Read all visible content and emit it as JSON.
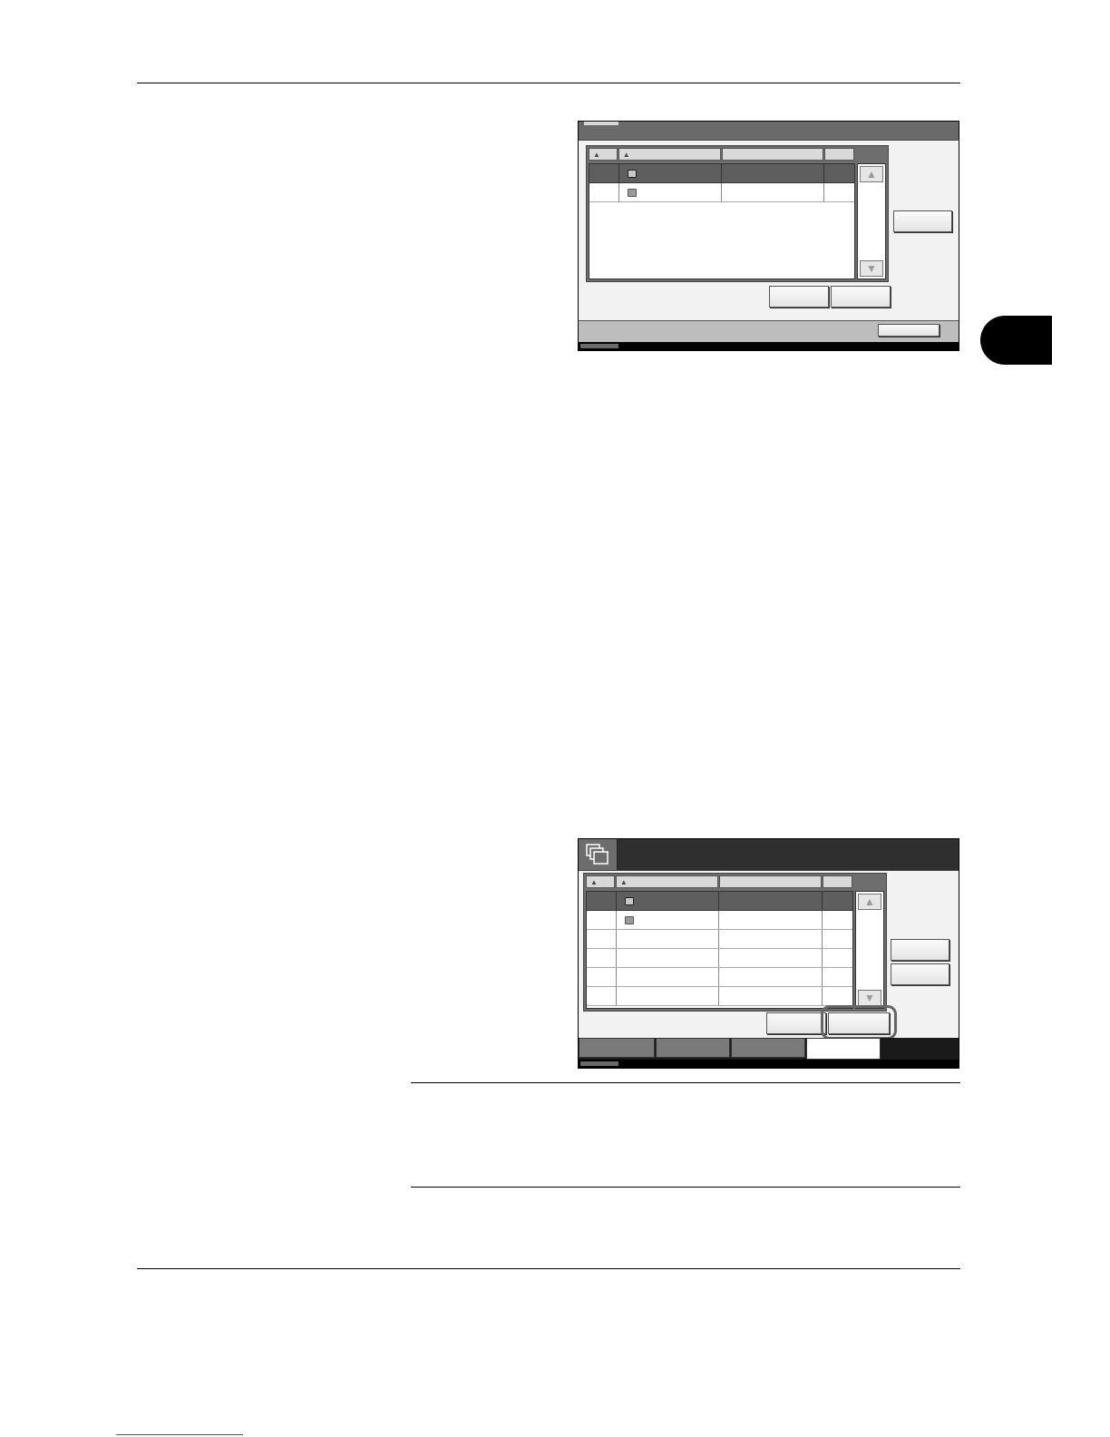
{
  "page": {
    "header_rule": true,
    "chapter_tab": {
      "number": ""
    },
    "footer": {
      "link_text": ""
    }
  },
  "screen_1": {
    "title": "",
    "columns": [
      "",
      "",
      "",
      ""
    ],
    "rows": [
      {
        "selected": true,
        "icon": "folder-icon"
      },
      {
        "selected": false,
        "icon": "folder-icon"
      }
    ],
    "buttons": {
      "side": "",
      "bottom_left": "",
      "bottom_right": "",
      "status_button": ""
    }
  },
  "screen_2": {
    "title": "",
    "icon": "document-box-icon",
    "columns": [
      "",
      "",
      "",
      ""
    ],
    "rows": [
      {
        "selected": true,
        "icon": "folder-icon"
      },
      {
        "selected": false,
        "icon": "folder-icon"
      },
      {
        "selected": false
      },
      {
        "selected": false
      },
      {
        "selected": false
      },
      {
        "selected": false
      }
    ],
    "buttons": {
      "side_1": "",
      "side_2": "",
      "bottom_left": "",
      "bottom_right_highlighted": ""
    },
    "tabs": [
      "",
      "",
      "",
      ""
    ],
    "active_tab": 3
  },
  "note": {
    "text": ""
  }
}
